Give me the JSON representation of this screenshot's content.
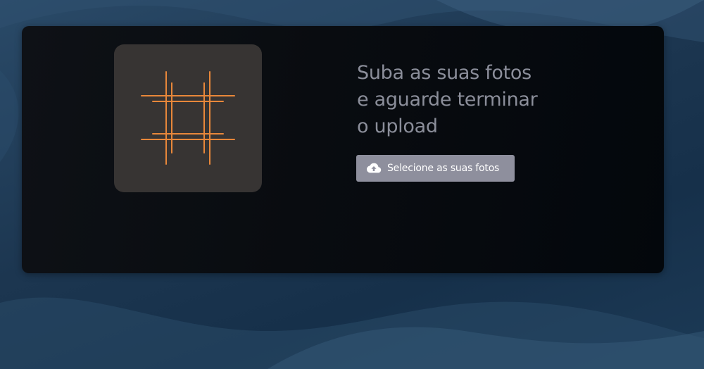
{
  "hero": {
    "headline_lines": [
      "Suba as suas fotos",
      "e aguarde terminar",
      "o upload"
    ]
  },
  "upload_button": {
    "label": "Selecione as suas fotos",
    "icon": "cloud-upload-icon"
  },
  "logo": {
    "icon": "hash-grid-logo-icon"
  },
  "colors": {
    "page_background": "#1f3a55",
    "card_background": "#090c10",
    "logo_tile": "#373433",
    "logo_stroke": "#e8873a",
    "headline_text": "#8b8e9a",
    "button_background": "#8e8f9d",
    "button_text": "#ffffff"
  }
}
